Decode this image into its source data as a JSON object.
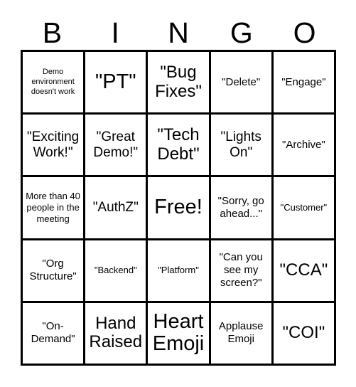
{
  "card": {
    "title": "BINGO",
    "header_letters": [
      "B",
      "I",
      "N",
      "G",
      "O"
    ],
    "columns": 5,
    "rows": 5,
    "border_color": "#000000",
    "background_color": "#ffffff",
    "text_color": "#000000",
    "free_space": {
      "row": 3,
      "column": 3,
      "label": "Free!"
    }
  },
  "cells": [
    {
      "index": 0,
      "row": 1,
      "column": 1,
      "label": "Demo environment doesn't work",
      "size": "xs"
    },
    {
      "index": 1,
      "row": 1,
      "column": 2,
      "label": "\"PT\"",
      "size": "xxl"
    },
    {
      "index": 2,
      "row": 1,
      "column": 3,
      "label": "\"Bug Fixes\"",
      "size": "xl"
    },
    {
      "index": 3,
      "row": 1,
      "column": 4,
      "label": "\"Delete\"",
      "size": "md"
    },
    {
      "index": 4,
      "row": 1,
      "column": 5,
      "label": "\"Engage\"",
      "size": "md"
    },
    {
      "index": 5,
      "row": 2,
      "column": 1,
      "label": "\"Exciting Work!\"",
      "size": "lg"
    },
    {
      "index": 6,
      "row": 2,
      "column": 2,
      "label": "\"Great Demo!\"",
      "size": "lg"
    },
    {
      "index": 7,
      "row": 2,
      "column": 3,
      "label": "\"Tech Debt\"",
      "size": "xl"
    },
    {
      "index": 8,
      "row": 2,
      "column": 4,
      "label": "\"Lights On\"",
      "size": "lg"
    },
    {
      "index": 9,
      "row": 2,
      "column": 5,
      "label": "\"Archive\"",
      "size": "md"
    },
    {
      "index": 10,
      "row": 3,
      "column": 1,
      "label": "More than 40 people in the meeting",
      "size": "sm"
    },
    {
      "index": 11,
      "row": 3,
      "column": 2,
      "label": "\"AuthZ\"",
      "size": "lg"
    },
    {
      "index": 12,
      "row": 3,
      "column": 3,
      "label": "Free!",
      "size": "xxl"
    },
    {
      "index": 13,
      "row": 3,
      "column": 4,
      "label": "\"Sorry, go ahead...\"",
      "size": "md"
    },
    {
      "index": 14,
      "row": 3,
      "column": 5,
      "label": "\"Customer\"",
      "size": "sm"
    },
    {
      "index": 15,
      "row": 4,
      "column": 1,
      "label": "\"Org Structure\"",
      "size": "md"
    },
    {
      "index": 16,
      "row": 4,
      "column": 2,
      "label": "\"Backend\"",
      "size": "sm"
    },
    {
      "index": 17,
      "row": 4,
      "column": 3,
      "label": "\"Platform\"",
      "size": "sm"
    },
    {
      "index": 18,
      "row": 4,
      "column": 4,
      "label": "\"Can you see my screen?\"",
      "size": "md"
    },
    {
      "index": 19,
      "row": 4,
      "column": 5,
      "label": "\"CCA\"",
      "size": "xl"
    },
    {
      "index": 20,
      "row": 5,
      "column": 1,
      "label": "\"On-Demand\"",
      "size": "md"
    },
    {
      "index": 21,
      "row": 5,
      "column": 2,
      "label": "Hand Raised",
      "size": "xl"
    },
    {
      "index": 22,
      "row": 5,
      "column": 3,
      "label": "Heart Emoji",
      "size": "xxl"
    },
    {
      "index": 23,
      "row": 5,
      "column": 4,
      "label": "Applause Emoji",
      "size": "md"
    },
    {
      "index": 24,
      "row": 5,
      "column": 5,
      "label": "\"COI\"",
      "size": "xl"
    }
  ]
}
